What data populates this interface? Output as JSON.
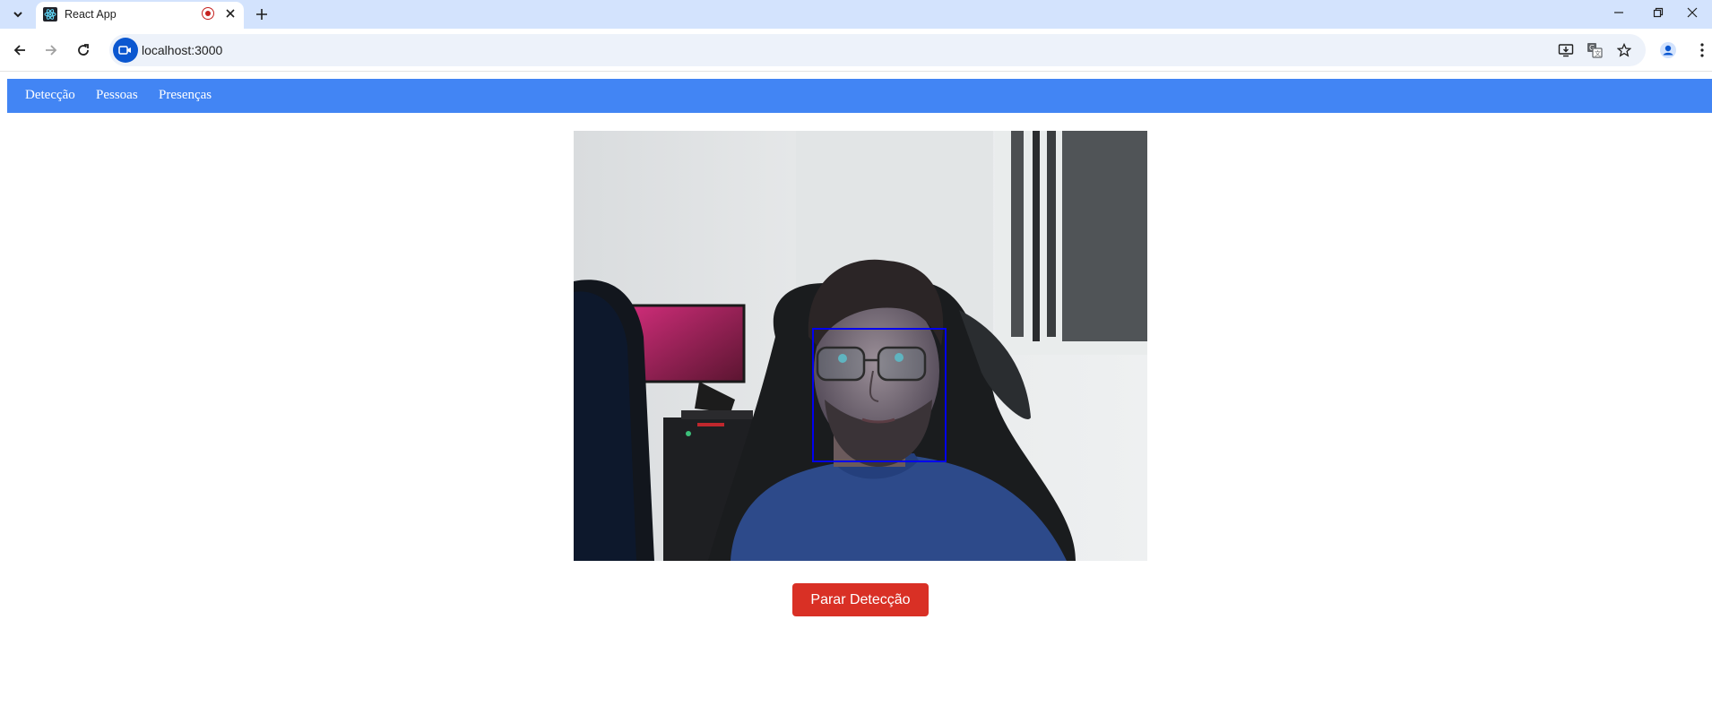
{
  "browser": {
    "tab_title": "React App",
    "url": "localhost:3000"
  },
  "nav": {
    "items": [
      {
        "label": "Detecção"
      },
      {
        "label": "Pessoas"
      },
      {
        "label": "Presenças"
      }
    ]
  },
  "main": {
    "stop_button_label": "Parar Detecção"
  },
  "colors": {
    "nav_background": "#4285f4",
    "stop_button": "#d93025",
    "face_box": "#0000ee",
    "tabstrip": "#d3e3fd"
  },
  "icons": {
    "tab_search": "chevron-down-icon",
    "favicon": "react-icon",
    "tab_status": "recording-icon",
    "tab_close": "close-icon",
    "new_tab": "plus-icon",
    "back": "arrow-left-icon",
    "forward": "arrow-right-icon",
    "reload": "reload-icon",
    "site_info": "camera-icon",
    "install": "install-app-icon",
    "translate": "translate-icon",
    "bookmark": "star-icon",
    "profile": "profile-icon",
    "menu": "more-vert-icon"
  }
}
